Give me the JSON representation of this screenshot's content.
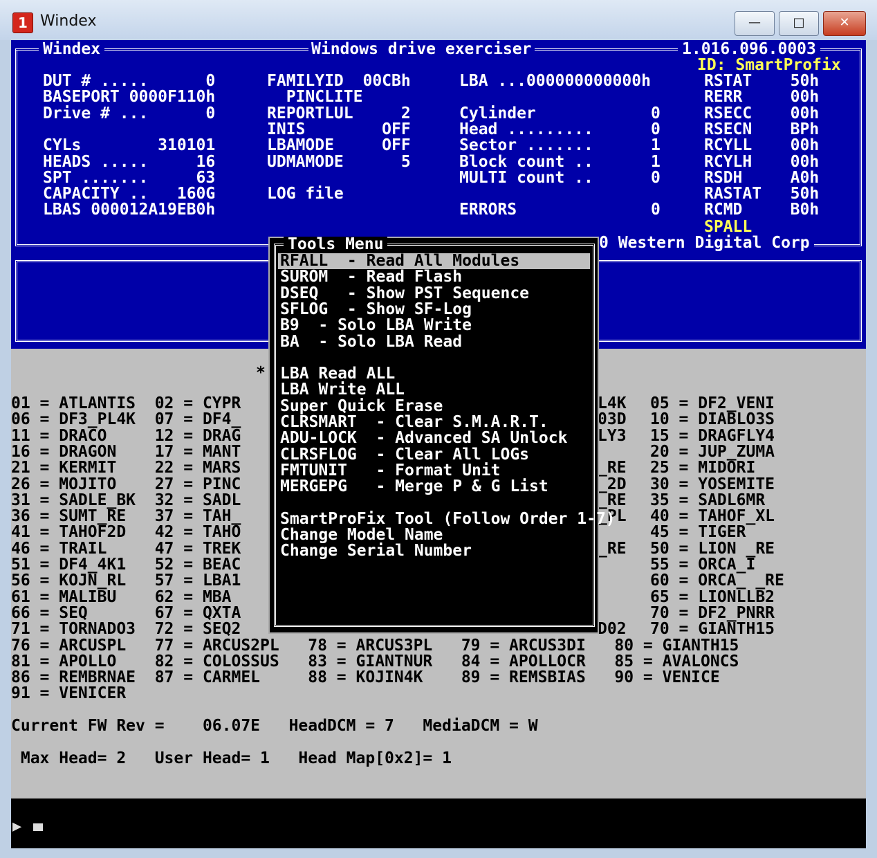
{
  "window": {
    "title": "Windex",
    "min": "—",
    "max": "□",
    "close": "✕"
  },
  "header": {
    "left": "Windex",
    "center": "Windows drive exerciser",
    "version": "1.016.096.0003",
    "id": "ID: SmartProfix",
    "copyright": "0 Western Digital Corp"
  },
  "info_col1": [
    "DUT # .....      0",
    "BASEPORT 0000F110h",
    "Drive # ...      0",
    "",
    "CYLs        310101",
    "HEADS .....     16",
    "SPT .......     63",
    "CAPACITY ..   160G",
    "LBAS 000012A19EB0h"
  ],
  "info_col2": [
    "FAMILYID  00CBh",
    "  PINCLITE",
    "REPORTLUL     2",
    "INIS        OFF",
    "LBAMODE     OFF",
    "UDMAMODE      5",
    "",
    "LOG file"
  ],
  "info_col3": [
    "LBA ...000000000000h",
    "",
    "Cylinder            0",
    "Head .........      0",
    "Sector .......      1",
    "Block count ..      1",
    "MULTI count ..      0",
    "",
    "ERRORS              0"
  ],
  "info_col4": [
    "RSTAT    50h",
    "RERR     00h",
    "RSECC    00h",
    "RSECN    BPh",
    "RCYLL    00h",
    "RCYLH    00h",
    "RSDH     A0h",
    "RASTAT   50h",
    "RCMD     B0h"
  ],
  "spall": "SPALL",
  "menu": {
    "title": "Tools Menu",
    "items": [
      "RFALL  - Read All Modules",
      "SUROM  - Read Flash",
      "DSEQ   - Show PST Sequence",
      "SFLOG  - Show SF-Log",
      "B9  - Solo LBA Write",
      "BA  - Solo LBA Read",
      "",
      "LBA Read ALL",
      "LBA Write ALL",
      "Super Quick Erase",
      "CLRSMART  - Clear S.M.A.R.T.",
      "ADU-LOCK  - Advanced SA Unlock",
      "CLRSFLOG  - Clear All LOGs",
      "FMTUNIT   - Format Unit",
      "MERGEPG   - Merge P & G List",
      "",
      "SmartProFix Tool (Follow Order 1-7)",
      "Change Model Name",
      "Change Serial Number"
    ]
  },
  "asterisk": "*",
  "family_rows": [
    "01 = ATLANTIS  02 = CYPR",
    "06 = DF3_PL4K  07 = DF4_",
    "11 = DRACO     12 = DRAG",
    "16 = DRAGON    17 = MANT",
    "21 = KERMIT    22 = MARS",
    "26 = MOJITO    27 = PINC",
    "31 = SADLE_BK  32 = SADL",
    "36 = SUMT_RE   37 = TAH_",
    "41 = TAHOF2D   42 = TAHO",
    "46 = TRAIL     47 = TREK",
    "51 = DF4_4K1   52 = BEAC",
    "56 = KOJN_RL   57 = LBA1",
    "61 = MALIBU    62 = MBA",
    "66 = SEQ       67 = QXTA",
    "71 = TORNADO3  72 = SEQ2",
    "76 = ARCUSPL   77 = ARCUS2PL   78 = ARCUS3PL   79 = ARCUS3DI   80 = GIANTH15",
    "81 = APOLLO    82 = COLOSSUS   83 = GIANTNUR   84 = APOLLOCR   85 = AVALONCS",
    "86 = REMBRNAE  87 = CARMEL     88 = KOJIN4K    89 = REMSBIAS   90 = VENICE",
    "91 = VENICER"
  ],
  "family_mid_right": [
    "L4K",
    "03D",
    "LY3",
    "",
    "_RE",
    "_2D",
    "_RE",
    "_PL",
    "",
    "_RE",
    "",
    "",
    "",
    "",
    "D02"
  ],
  "family_right": [
    "05 = DF2_VENI",
    "10 = DIABLO3S",
    "15 = DRAGFLY4",
    "20 = JUP_ZUMA",
    "25 = MIDORI",
    "30 = YOSEMITE",
    "35 = SADL6MR",
    "40 = TAHOF_XL",
    "45 = TIGER",
    "50 = LION _RE",
    "55 = ORCA_I",
    "60 = ORCA_ _RE",
    "65 = LIONLLB2",
    "70 = DF2_PNRR",
    "70 = GIANTH15"
  ],
  "status": {
    "line1": "Current FW Rev =    06.07E   HeadDCM = 7   MediaDCM = W",
    "line2": " Max Head= 2   User Head= 1   Head Map[0x2]= 1"
  },
  "prompt": "▶"
}
